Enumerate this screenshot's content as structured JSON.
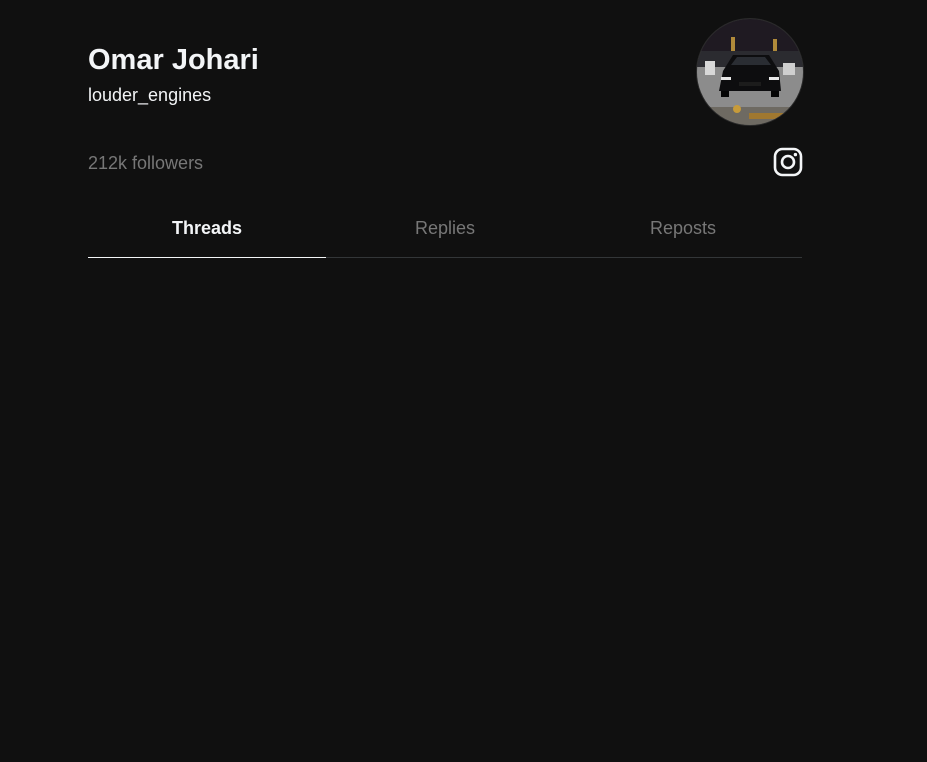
{
  "profile": {
    "display_name": "Omar Johari",
    "username": "louder_engines",
    "followers": "212k followers"
  },
  "tabs": [
    {
      "label": "Threads",
      "active": true
    },
    {
      "label": "Replies",
      "active": false
    },
    {
      "label": "Reposts",
      "active": false
    }
  ],
  "icons": {
    "avatar": "avatar-photo",
    "instagram": "instagram-icon"
  },
  "colors": {
    "background": "#101010",
    "primary_text": "#f3f5f7",
    "secondary_text": "#777777",
    "divider": "#333638"
  }
}
